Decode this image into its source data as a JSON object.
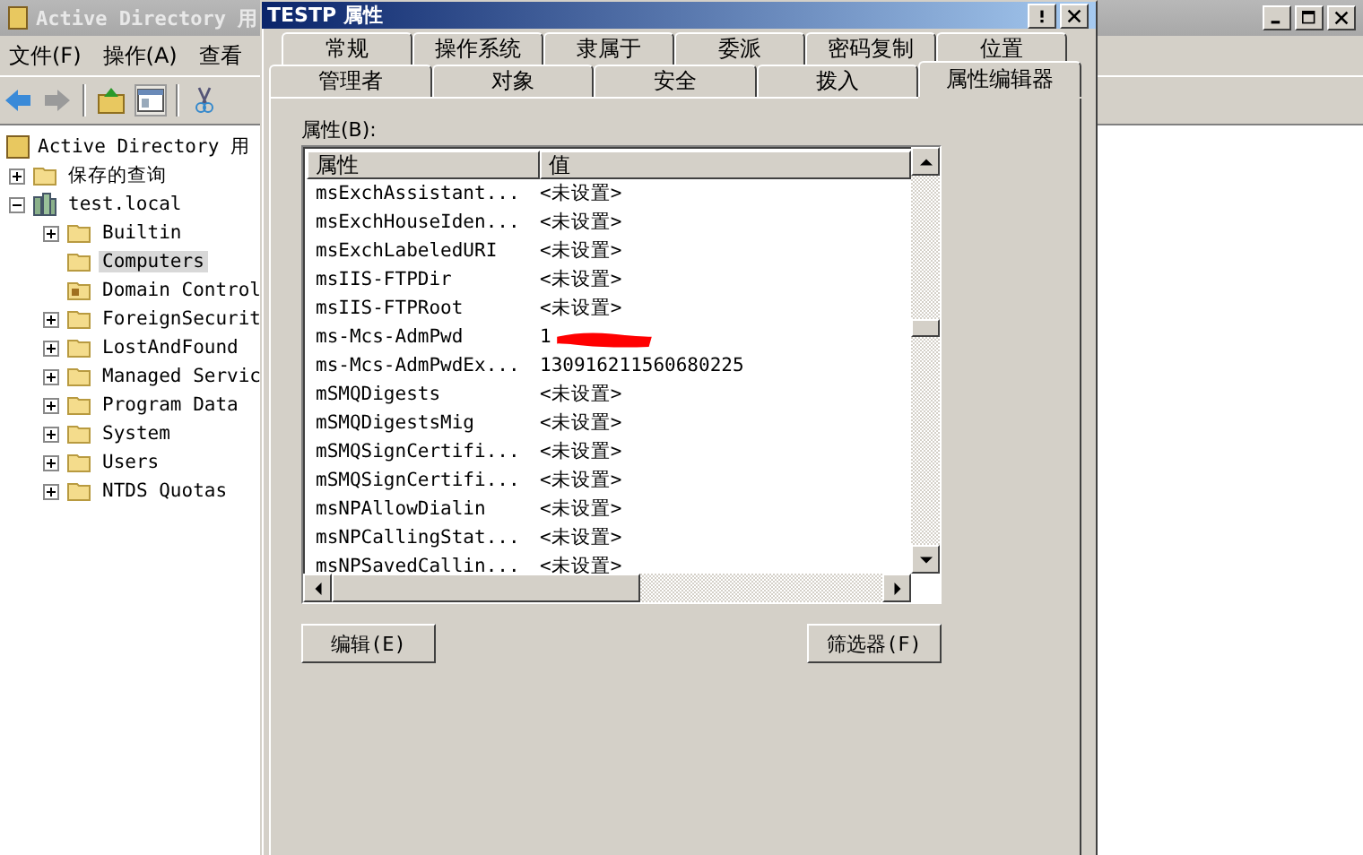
{
  "main_window": {
    "title": "Active Directory 用",
    "menu": [
      "文件(F)",
      "操作(A)",
      "查看"
    ],
    "tree": [
      {
        "label": "Active Directory 用",
        "kind": "root",
        "selected": false,
        "children": [
          {
            "label": "保存的查询",
            "kind": "folder",
            "expanded": false,
            "selected": false
          },
          {
            "label": "test.local",
            "kind": "domain",
            "expanded": true,
            "selected": false,
            "children": [
              {
                "label": "Builtin",
                "kind": "folder",
                "expanded": false,
                "selected": false
              },
              {
                "label": "Computers",
                "kind": "folder",
                "selected": true
              },
              {
                "label": "Domain Control",
                "kind": "ou",
                "selected": false
              },
              {
                "label": "ForeignSecurit",
                "kind": "folder",
                "expanded": false,
                "selected": false
              },
              {
                "label": "LostAndFound",
                "kind": "folder",
                "expanded": false,
                "selected": false
              },
              {
                "label": "Managed Servic",
                "kind": "folder",
                "expanded": false,
                "selected": false
              },
              {
                "label": "Program Data",
                "kind": "folder",
                "expanded": false,
                "selected": false
              },
              {
                "label": "System",
                "kind": "folder",
                "expanded": false,
                "selected": false
              },
              {
                "label": "Users",
                "kind": "folder",
                "expanded": false,
                "selected": false
              },
              {
                "label": "NTDS Quotas",
                "kind": "folder",
                "expanded": false,
                "selected": false
              }
            ]
          }
        ]
      }
    ]
  },
  "dialog": {
    "title": "TESTP 属性",
    "tabs_back": [
      {
        "label": "常规",
        "selected": false
      },
      {
        "label": "操作系统",
        "selected": false
      },
      {
        "label": "隶属于",
        "selected": false
      },
      {
        "label": "委派",
        "selected": false
      },
      {
        "label": "密码复制",
        "selected": false
      },
      {
        "label": "位置",
        "selected": false
      }
    ],
    "tabs_front": [
      {
        "label": "管理者",
        "selected": false
      },
      {
        "label": "对象",
        "selected": false
      },
      {
        "label": "安全",
        "selected": false
      },
      {
        "label": "拨入",
        "selected": false
      },
      {
        "label": "属性编辑器",
        "selected": true
      }
    ],
    "list_label": "属性(B):",
    "columns": [
      "属性",
      "值"
    ],
    "rows": [
      {
        "attribute": "msExchAssistant...",
        "value": "<未设置>",
        "redacted": false
      },
      {
        "attribute": "msExchHouseIden...",
        "value": "<未设置>",
        "redacted": false
      },
      {
        "attribute": "msExchLabeledURI",
        "value": "<未设置>",
        "redacted": false
      },
      {
        "attribute": "msIIS-FTPDir",
        "value": "<未设置>",
        "redacted": false
      },
      {
        "attribute": "msIIS-FTPRoot",
        "value": "<未设置>",
        "redacted": false
      },
      {
        "attribute": "ms-Mcs-AdmPwd",
        "value": "1",
        "redacted": true
      },
      {
        "attribute": "ms-Mcs-AdmPwdEx...",
        "value": "130916211560680225",
        "redacted": false
      },
      {
        "attribute": "mSMQDigests",
        "value": "<未设置>",
        "redacted": false
      },
      {
        "attribute": "mSMQDigestsMig",
        "value": "<未设置>",
        "redacted": false
      },
      {
        "attribute": "mSMQSignCertifi...",
        "value": "<未设置>",
        "redacted": false
      },
      {
        "attribute": "mSMQSignCertifi...",
        "value": "<未设置>",
        "redacted": false
      },
      {
        "attribute": "msNPAllowDialin",
        "value": "<未设置>",
        "redacted": false
      },
      {
        "attribute": "msNPCallingStat...",
        "value": "<未设置>",
        "redacted": false
      },
      {
        "attribute": "msNPSavedCallin...",
        "value": "<未设置>",
        "redacted": false
      }
    ],
    "buttons": [
      "编辑(E)",
      "筛选器(F)"
    ]
  }
}
